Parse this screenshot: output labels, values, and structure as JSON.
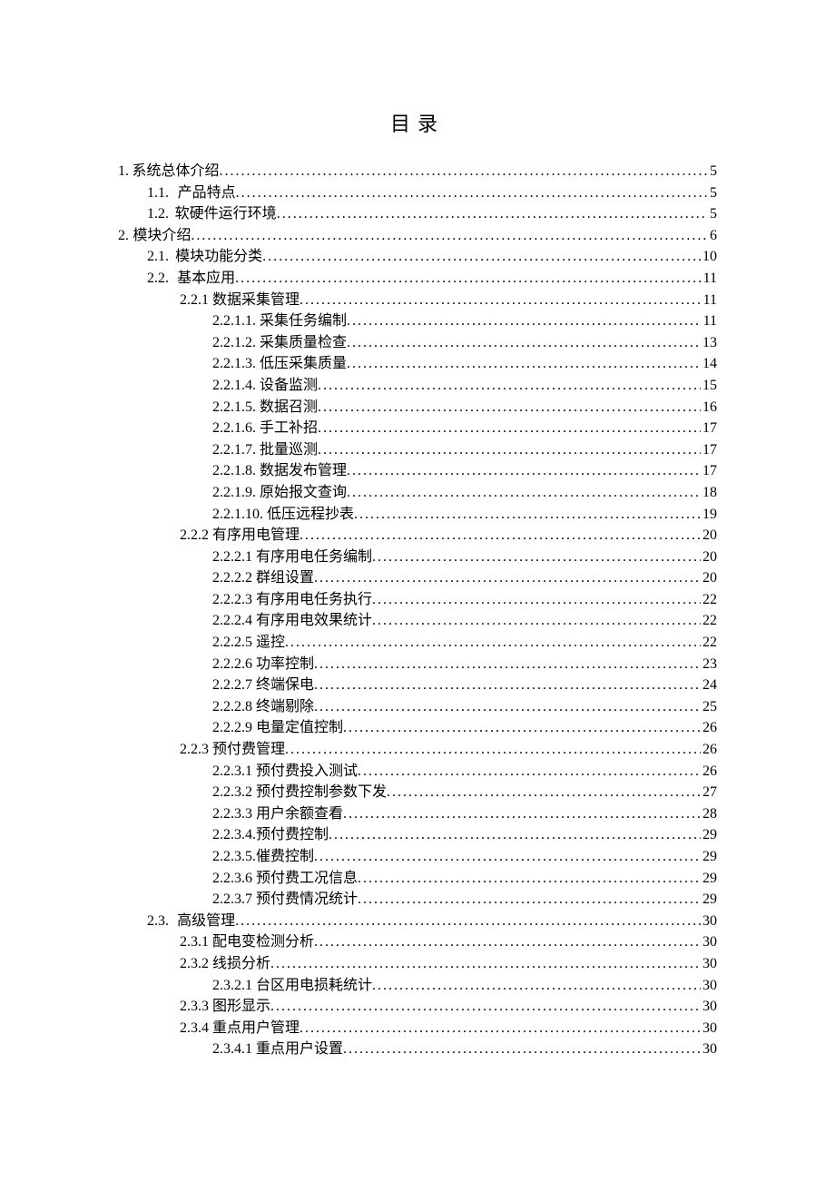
{
  "title": "目录",
  "entries": [
    {
      "level": 1,
      "num": "1.",
      "label": "系统总体介绍",
      "page": "5"
    },
    {
      "level": 2,
      "num": "1.1.",
      "label": "产品特点",
      "page": "5"
    },
    {
      "level": 2,
      "num": "1.2.",
      "label": "软硬件运行环境",
      "page": "5"
    },
    {
      "level": 1,
      "num": "2.",
      "label": "模块介绍",
      "page": "6"
    },
    {
      "level": 2,
      "num": "2.1.",
      "label": "模块功能分类",
      "page": "10"
    },
    {
      "level": 2,
      "num": "2.2.",
      "label": "基本应用",
      "page": "11"
    },
    {
      "level": 3,
      "num": "",
      "label": "2.2.1 数据采集管理",
      "page": "11"
    },
    {
      "level": 4,
      "num": "",
      "label": "2.2.1.1. 采集任务编制",
      "page": "11"
    },
    {
      "level": 4,
      "num": "",
      "label": "2.2.1.2. 采集质量检查",
      "page": "13"
    },
    {
      "level": 4,
      "num": "",
      "label": "2.2.1.3. 低压采集质量",
      "page": "14"
    },
    {
      "level": 4,
      "num": "",
      "label": "2.2.1.4. 设备监测",
      "page": "15"
    },
    {
      "level": 4,
      "num": "",
      "label": "2.2.1.5. 数据召测",
      "page": "16"
    },
    {
      "level": 4,
      "num": "",
      "label": "2.2.1.6. 手工补招",
      "page": "17"
    },
    {
      "level": 4,
      "num": "",
      "label": "2.2.1.7. 批量巡测",
      "page": "17"
    },
    {
      "level": 4,
      "num": "",
      "label": "2.2.1.8. 数据发布管理",
      "page": "17"
    },
    {
      "level": 4,
      "num": "",
      "label": "2.2.1.9. 原始报文查询",
      "page": "18"
    },
    {
      "level": 4,
      "num": "",
      "label": "2.2.1.10. 低压远程抄表",
      "page": "19"
    },
    {
      "level": 3,
      "num": "",
      "label": "2.2.2 有序用电管理",
      "page": "20"
    },
    {
      "level": 4,
      "num": "",
      "label": "2.2.2.1 有序用电任务编制",
      "page": "20"
    },
    {
      "level": 4,
      "num": "",
      "label": "2.2.2.2 群组设置",
      "page": "20"
    },
    {
      "level": 4,
      "num": "",
      "label": "2.2.2.3 有序用电任务执行",
      "page": "22"
    },
    {
      "level": 4,
      "num": "",
      "label": "2.2.2.4 有序用电效果统计",
      "page": "22"
    },
    {
      "level": 4,
      "num": "",
      "label": "2.2.2.5 遥控",
      "page": "22"
    },
    {
      "level": 4,
      "num": "",
      "label": "2.2.2.6 功率控制",
      "page": "23"
    },
    {
      "level": 4,
      "num": "",
      "label": "2.2.2.7 终端保电",
      "page": "24"
    },
    {
      "level": 4,
      "num": "",
      "label": "2.2.2.8 终端剔除",
      "page": "25"
    },
    {
      "level": 4,
      "num": "",
      "label": "2.2.2.9 电量定值控制",
      "page": "26"
    },
    {
      "level": 3,
      "num": "",
      "label": "2.2.3 预付费管理",
      "page": "26"
    },
    {
      "level": 4,
      "num": "",
      "label": "2.2.3.1 预付费投入测试",
      "page": "26"
    },
    {
      "level": 4,
      "num": "",
      "label": "2.2.3.2 预付费控制参数下发",
      "page": "27"
    },
    {
      "level": 4,
      "num": "",
      "label": "2.2.3.3 用户余额查看",
      "page": "28"
    },
    {
      "level": 4,
      "num": "",
      "label": "2.2.3.4.预付费控制",
      "page": "29"
    },
    {
      "level": 4,
      "num": "",
      "label": "2.2.3.5.催费控制",
      "page": "29"
    },
    {
      "level": 4,
      "num": "",
      "label": "2.2.3.6 预付费工况信息",
      "page": "29"
    },
    {
      "level": 4,
      "num": "",
      "label": "2.2.3.7 预付费情况统计",
      "page": "29"
    },
    {
      "level": 2,
      "num": "2.3.",
      "label": "高级管理",
      "page": "30"
    },
    {
      "level": 3,
      "num": "",
      "label": "2.3.1 配电变检测分析",
      "page": "30"
    },
    {
      "level": 3,
      "num": "",
      "label": "2.3.2 线损分析",
      "page": "30"
    },
    {
      "level": 4,
      "num": "",
      "label": "2.3.2.1 台区用电损耗统计",
      "page": "30"
    },
    {
      "level": 3,
      "num": "",
      "label": "2.3.3 图形显示",
      "page": "30"
    },
    {
      "level": 3,
      "num": "",
      "label": "2.3.4 重点用户管理",
      "page": "30"
    },
    {
      "level": 4,
      "num": "",
      "label": "2.3.4.1 重点用户设置",
      "page": "30"
    }
  ]
}
